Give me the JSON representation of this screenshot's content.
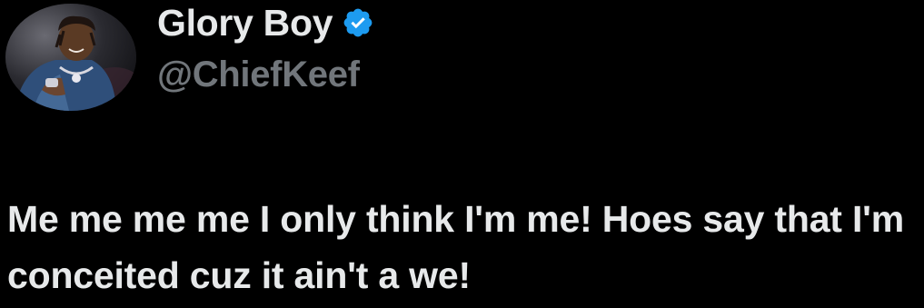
{
  "author": {
    "display_name": "Glory Boy",
    "handle": "@ChiefKeef",
    "verified": true,
    "avatar_icon": "profile-photo"
  },
  "tweet": {
    "text": "Me me me me I only think I'm me! Hoes say that I'm conceited cuz it ain't a we!"
  },
  "colors": {
    "background": "#000000",
    "text": "#e7e9ea",
    "secondary_text": "#71767b",
    "verified_badge": "#1d9bf0"
  }
}
